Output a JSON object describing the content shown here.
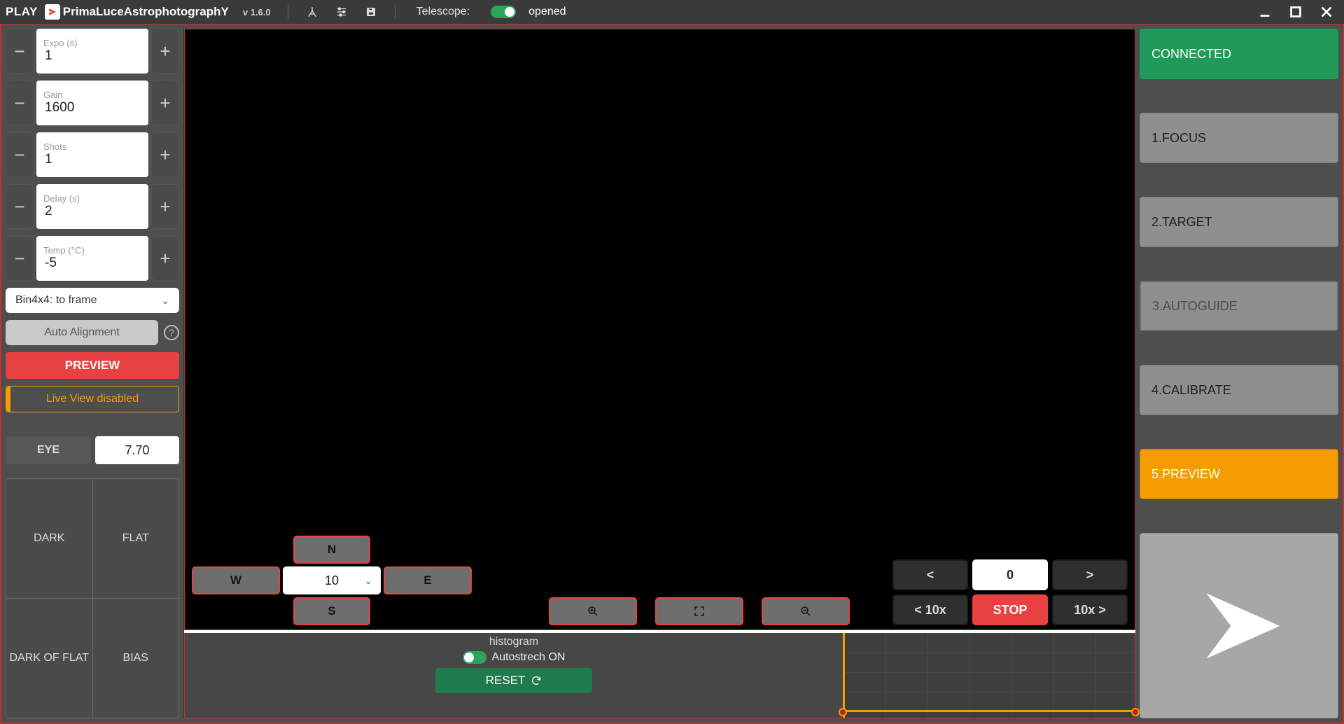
{
  "titlebar": {
    "play": "PLAY",
    "brand": "PrimaLuceAstrophotographY",
    "version": "v 1.6.0",
    "telescope_label": "Telescope:",
    "opened": "opened"
  },
  "left": {
    "expo": {
      "label": "Expo (s)",
      "value": "1"
    },
    "gain": {
      "label": "Gain",
      "value": "1600"
    },
    "shots": {
      "label": "Shots",
      "value": "1"
    },
    "delay": {
      "label": "Delay (s)",
      "value": "2"
    },
    "temp": {
      "label": "Temp (°C)",
      "value": "-5"
    },
    "binning": "Bin4x4: to frame",
    "auto_alignment": "Auto Alignment",
    "preview": "PREVIEW",
    "liveview": "Live View disabled",
    "eye_label": "EYE",
    "eye_value": "7.70",
    "quad": {
      "dark": "DARK",
      "flat": "FLAT",
      "darkofflat": "DARK OF FLAT",
      "bias": "BIAS"
    }
  },
  "center": {
    "dir": {
      "n": "N",
      "s": "S",
      "e": "E",
      "w": "W",
      "rate": "10"
    },
    "rate": {
      "left": "<",
      "center": "0",
      "right": ">",
      "left10": "< 10x",
      "stop": "STOP",
      "right10": "10x >"
    },
    "histogram": {
      "title": "histogram",
      "autostretch": "Autostrech ON",
      "reset": "RESET"
    }
  },
  "right": {
    "connected": "CONNECTED",
    "focus": "1.FOCUS",
    "target": "2.TARGET",
    "autoguide": "3.AUTOGUIDE",
    "calibrate": "4.CALIBRATE",
    "preview": "5.PREVIEW"
  }
}
